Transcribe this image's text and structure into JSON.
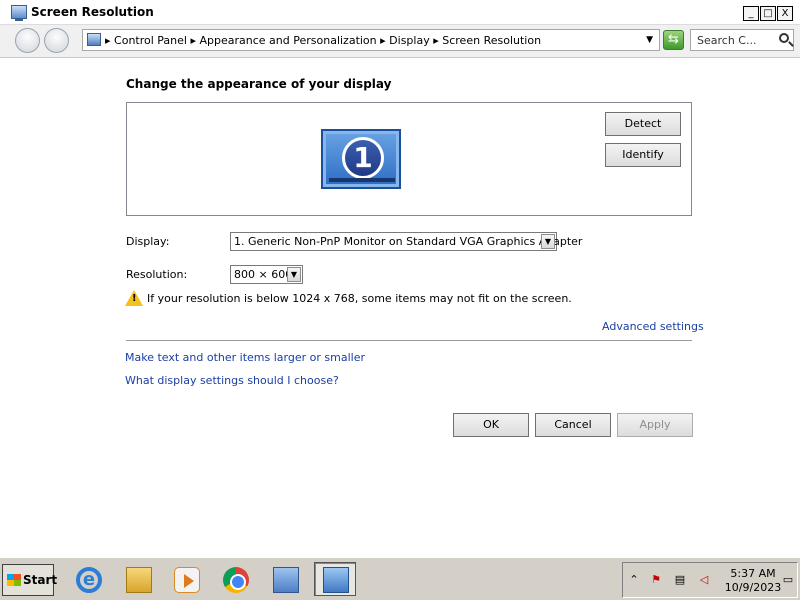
{
  "window": {
    "title": "Screen Resolution",
    "controls": {
      "minimize": "_",
      "maximize": "□",
      "close": "X"
    }
  },
  "address_bar": {
    "breadcrumbs": [
      "Control Panel",
      "Appearance and Personalization",
      "Display",
      "Screen Resolution"
    ],
    "separator": "▸",
    "search_placeholder": "Search C..."
  },
  "content": {
    "heading": "Change the appearance of your display",
    "monitor_number": "1",
    "detect_label": "Detect",
    "identify_label": "Identify",
    "display_label": "Display:",
    "display_value": "1. Generic Non-PnP Monitor on Standard VGA Graphics Adapter",
    "resolution_label": "Resolution:",
    "resolution_value": "800 × 600",
    "warning_text": "If your resolution is below 1024 x 768, some items may not fit on the screen.",
    "advanced_link": "Advanced settings",
    "link_larger": "Make text and other items larger or smaller",
    "link_choose": "What display settings should I choose?",
    "ok_label": "OK",
    "cancel_label": "Cancel",
    "apply_label": "Apply"
  },
  "taskbar": {
    "start_label": "Start",
    "apps": [
      "internet-explorer",
      "file-explorer",
      "media-player",
      "chrome",
      "network-connections",
      "screen-resolution"
    ],
    "clock_time": "5:37 AM",
    "clock_date": "10/9/2023"
  },
  "colors": {
    "link": "#1a3ea3",
    "accent": "#2c6cc6"
  }
}
